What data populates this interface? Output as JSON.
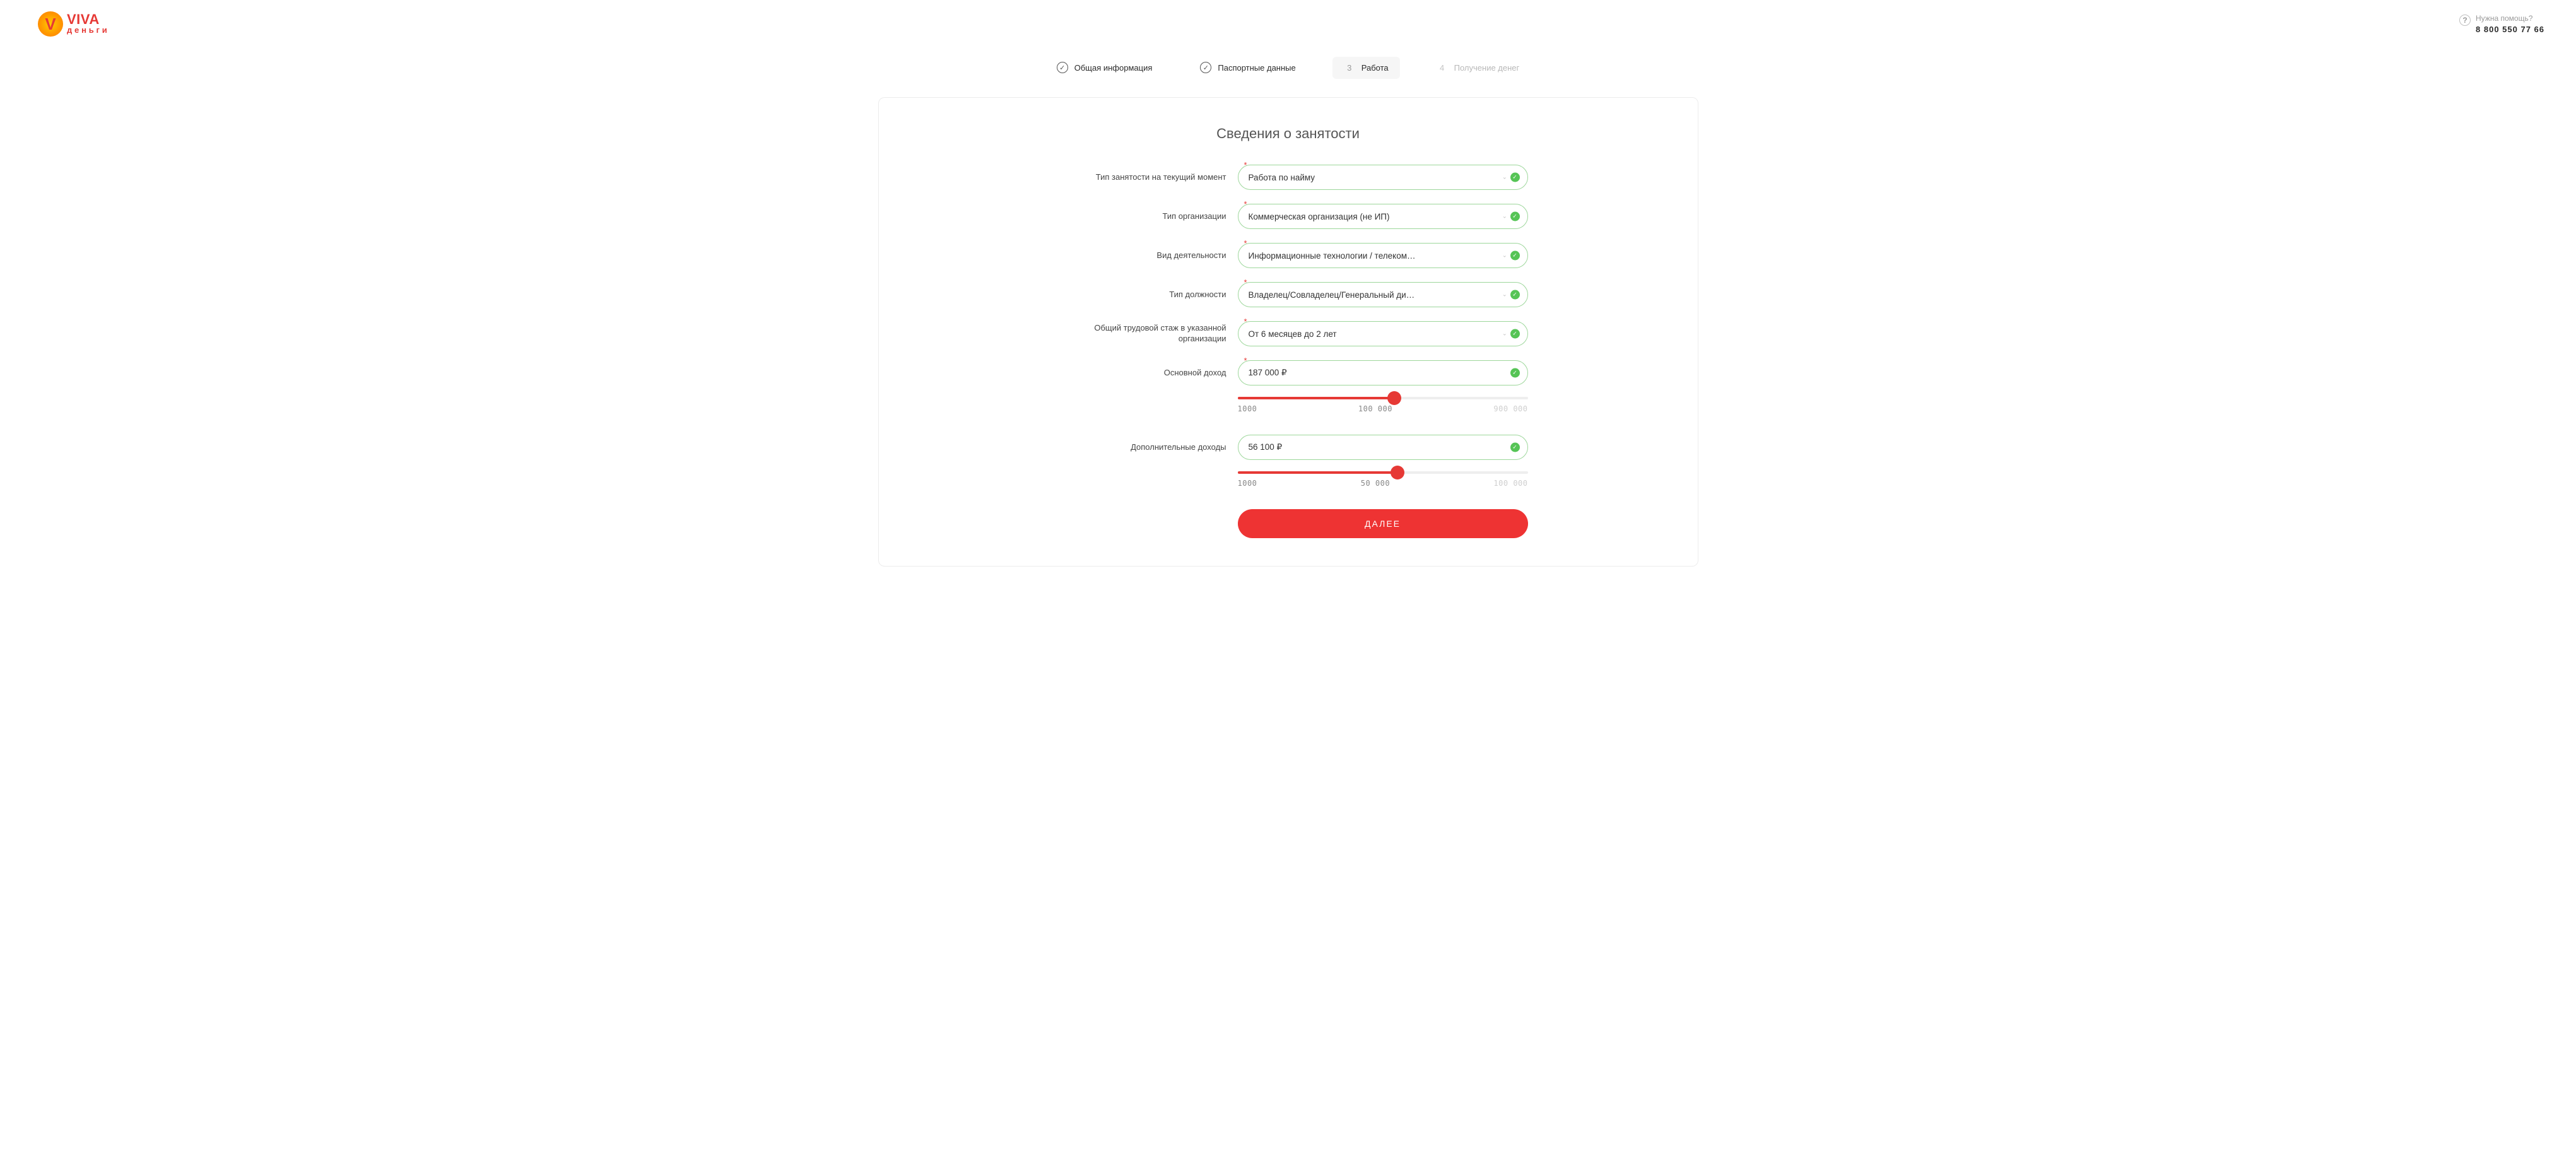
{
  "header": {
    "logo_top": "VIVA",
    "logo_bottom": "деньги",
    "help_label": "Нужна помощь?",
    "help_phone": "8 800 550 77 66"
  },
  "steps": [
    {
      "label": "Общая информация",
      "state": "done"
    },
    {
      "label": "Паспортные данные",
      "state": "done"
    },
    {
      "num": "3",
      "label": "Работа",
      "state": "active"
    },
    {
      "num": "4",
      "label": "Получение денег",
      "state": "inactive"
    }
  ],
  "title": "Сведения о занятости",
  "fields": {
    "employment_type": {
      "label": "Тип занятости на текущий момент",
      "value": "Работа по найму"
    },
    "org_type": {
      "label": "Тип организации",
      "value": "Коммерческая организация (не ИП)"
    },
    "activity": {
      "label": "Вид деятельности",
      "value": "Информационные технологии / телеком…"
    },
    "position": {
      "label": "Тип должности",
      "value": "Владелец/Совладелец/Генеральный ди…"
    },
    "tenure": {
      "label": "Общий трудовой стаж в указанной организации",
      "value": "От 6 месяцев до 2 лет"
    },
    "income": {
      "label": "Основной доход",
      "value": "187 000 ₽"
    },
    "extra_income": {
      "label": "Дополнительные доходы",
      "value": "56 100 ₽"
    }
  },
  "slider_income": {
    "min_label": "1000",
    "mid_label": "100 000",
    "max_label": "900 000",
    "fill_percent": 54
  },
  "slider_extra": {
    "min_label": "1000",
    "mid_label": "50 000",
    "max_label": "100 000",
    "fill_percent": 55
  },
  "submit_label": "ДАЛЕЕ"
}
